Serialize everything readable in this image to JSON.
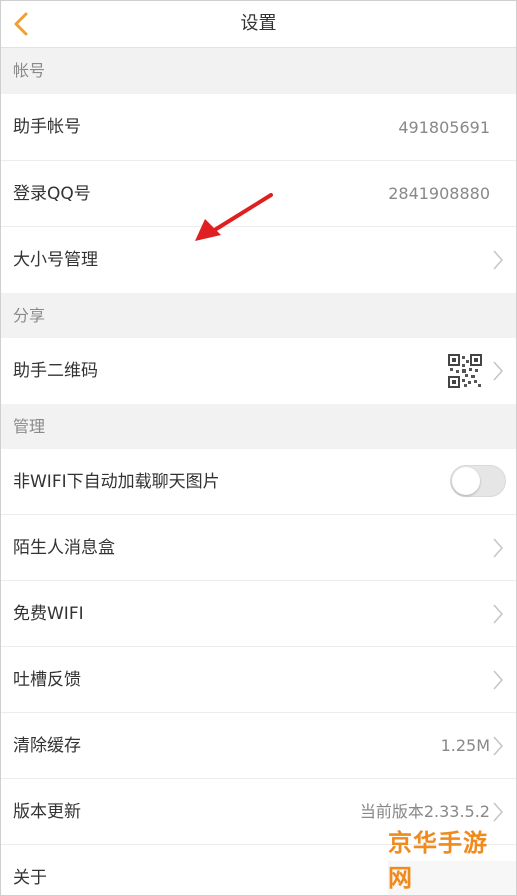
{
  "header": {
    "title": "设置",
    "back_icon": "chevron-left-icon",
    "accent_color": "#f0a030"
  },
  "sections": {
    "account": "帐号",
    "share": "分享",
    "manage": "管理"
  },
  "rows": {
    "assistant_account": {
      "label": "助手帐号",
      "value": "491805691"
    },
    "login_qq": {
      "label": "登录QQ号",
      "value": "2841908880"
    },
    "account_manage": {
      "label": "大小号管理"
    },
    "qr_code": {
      "label": "助手二维码",
      "icon": "qr-code-icon"
    },
    "auto_load_images": {
      "label": "非WIFI下自动加载聊天图片",
      "toggle": false
    },
    "stranger_box": {
      "label": "陌生人消息盒"
    },
    "free_wifi": {
      "label": "免费WIFI"
    },
    "feedback": {
      "label": "吐槽反馈"
    },
    "clear_cache": {
      "label": "清除缓存",
      "value": "1.25M"
    },
    "version_update": {
      "label": "版本更新",
      "value": "当前版本2.33.5.2"
    },
    "about": {
      "label": "关于"
    }
  },
  "annotation": {
    "arrow_color": "#e02020"
  },
  "watermark": {
    "text": "京华手游网",
    "color": "#f08a1c"
  }
}
